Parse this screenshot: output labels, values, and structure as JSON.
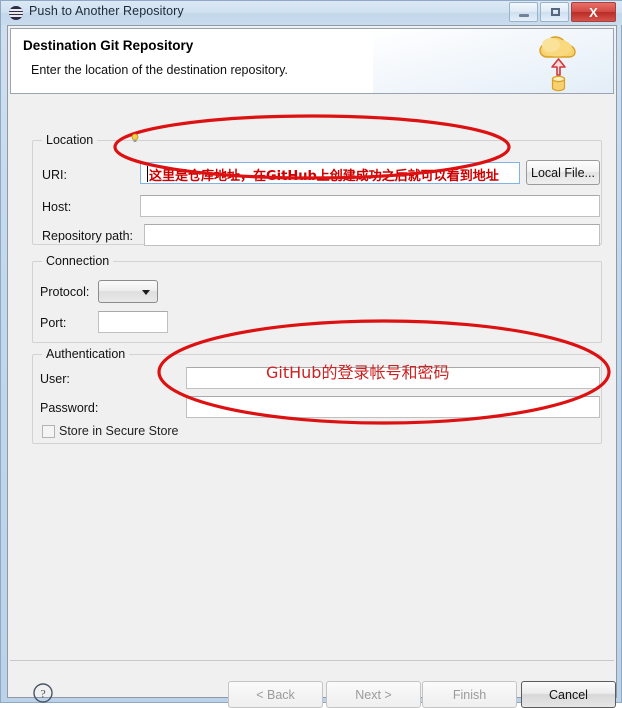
{
  "window": {
    "title": "Push to Another Repository",
    "icon": "eclipse-icon",
    "controls": {
      "minimize": "minimize-icon",
      "maximize": "maximize-icon",
      "close": "X"
    }
  },
  "header": {
    "title": "Destination Git Repository",
    "description": "Enter the location of the destination repository.",
    "icon": "push-to-cloud-icon"
  },
  "location": {
    "group_label": "Location",
    "uri_label": "URI:",
    "uri_value": "这里是仓库地址，在GitHub上创建成功之后就可以看到地址",
    "uri_decoration": "lightbulb-icon",
    "host_label": "Host:",
    "host_value": "",
    "repo_path_label": "Repository path:",
    "repo_path_value": "",
    "local_file_button": "Local File..."
  },
  "connection": {
    "group_label": "Connection",
    "protocol_label": "Protocol:",
    "protocol_value": "",
    "port_label": "Port:",
    "port_value": ""
  },
  "authentication": {
    "group_label": "Authentication",
    "user_label": "User:",
    "user_value": "",
    "password_label": "Password:",
    "password_value": "",
    "store_label": "Store in Secure Store",
    "store_checked": false
  },
  "annotations": {
    "uri_note": "这里是仓库地址，在GitHub上创建成功之后就可以看到地址",
    "auth_note": "GitHub的登录帐号和密码",
    "color": "#cc2222"
  },
  "footer": {
    "help_icon": "help-icon",
    "back_button": "< Back",
    "next_button": "Next >",
    "finish_button": "Finish",
    "cancel_button": "Cancel"
  },
  "colors": {
    "annotation_red": "#cc2222",
    "dialog_bg": "#f0f0f0",
    "frame_blue": "#c4d8ec",
    "cloud_yellow": "#f5cb5c"
  }
}
